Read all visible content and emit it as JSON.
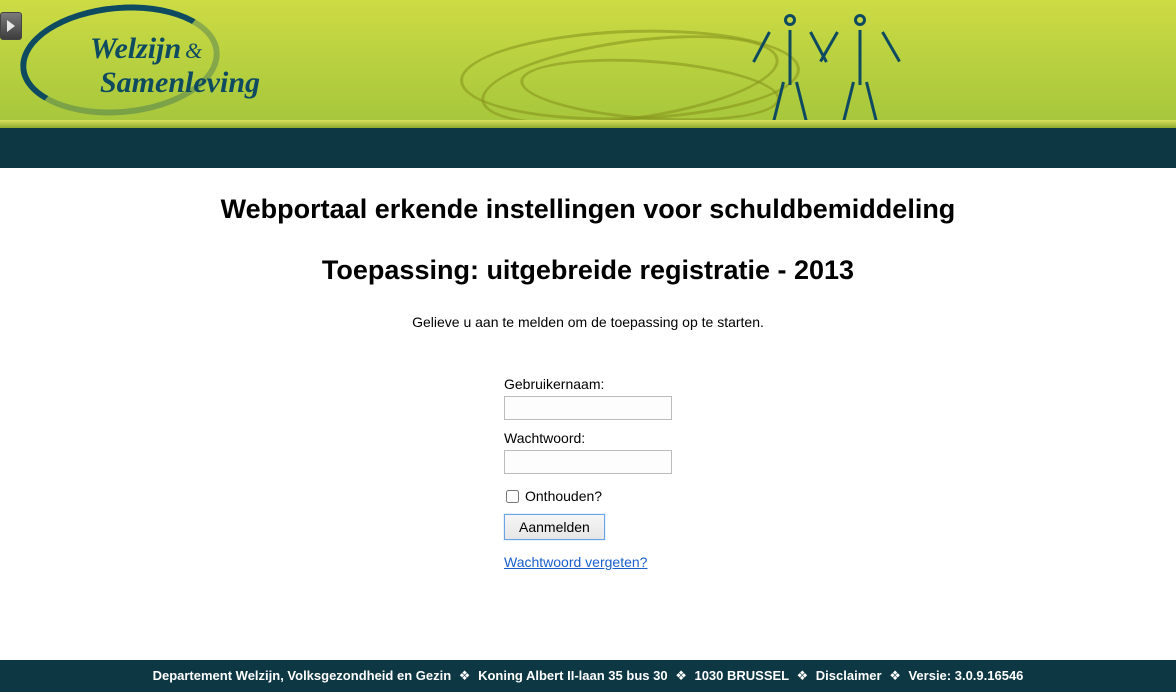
{
  "logo": {
    "line1": "Welzijn",
    "amp": "&",
    "line2": "Samenleving"
  },
  "main": {
    "title": "Webportaal erkende instellingen voor schuldbemiddeling",
    "subtitle": "Toepassing: uitgebreide registratie - 2013",
    "instruction": "Gelieve u aan te melden om de toepassing op te starten."
  },
  "form": {
    "username_label": "Gebruikernaam:",
    "username_value": "",
    "password_label": "Wachtwoord:",
    "password_value": "",
    "remember_label": "Onthouden?",
    "submit_label": "Aanmelden",
    "forgot_label": "Wachtwoord vergeten?"
  },
  "footer": {
    "department": "Departement Welzijn, Volksgezondheid en Gezin",
    "address1": "Koning Albert II-laan 35 bus 30",
    "address2": "1030 BRUSSEL",
    "disclaimer_label": "Disclaimer",
    "version_label": "Versie: 3.0.9.16546",
    "separator": "❖"
  }
}
